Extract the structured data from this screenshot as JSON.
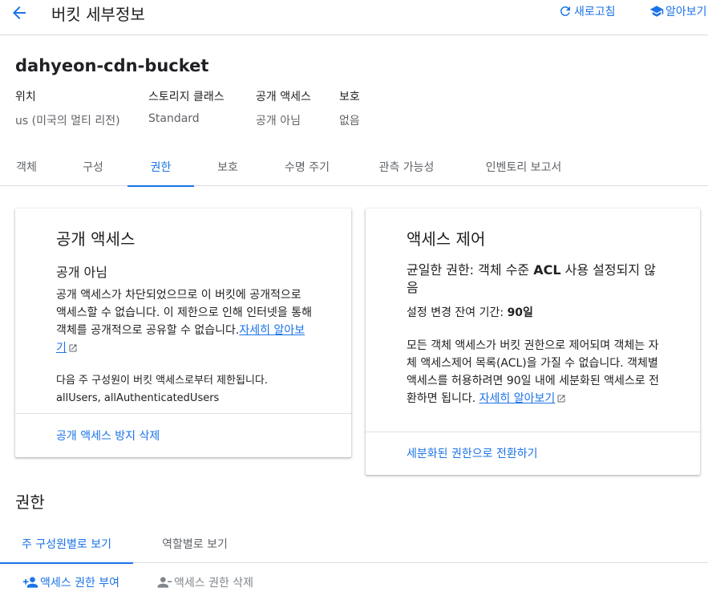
{
  "header": {
    "title": "버킷 세부정보",
    "refresh_label": "새로고침",
    "learn_label": "알아보기"
  },
  "bucket": {
    "name": "dahyeon-cdn-bucket",
    "meta": [
      {
        "label": "위치",
        "value": "us (미국의 멀티 리전)"
      },
      {
        "label": "스토리지 클래스",
        "value": "Standard"
      },
      {
        "label": "공개 액세스",
        "value": "공개 아님"
      },
      {
        "label": "보호",
        "value": "없음"
      }
    ]
  },
  "tabs": [
    "객체",
    "구성",
    "권한",
    "보호",
    "수명 주기",
    "관측 가능성",
    "인벤토리 보고서"
  ],
  "active_tab": "권한",
  "public_access_card": {
    "title": "공개 액세스",
    "status": "공개 아님",
    "desc_lines": [
      "공개 액세스가 차단되었으므로 이 버킷에 공개적으로",
      "액세스할 수 없습니다. 이 제한으로 인해 인터넷을 통해",
      "객체를 공개적으로 공유할 수 없습니다."
    ],
    "learn_more_a": "자세히 알아보",
    "learn_more_b": "기",
    "restricted_note": "다음 주 구성원이 버킷 액세스로부터 제한됩니다.",
    "principals": "allUsers, allAuthenticatedUsers",
    "action": "공개 액세스 방지 삭제"
  },
  "access_control_card": {
    "title": "액세스 제어",
    "subtitle_prefix": "균일한 권한: 객체 수준 ",
    "subtitle_bold": "ACL",
    "subtitle_suffix": " 사용 설정되지 않",
    "subtitle_line2": "음",
    "remaining_label": "설정 변경 잔여 기간: ",
    "remaining_value": "90일",
    "desc_lines": [
      "모든 객체 액세스가 버킷 권한으로 제어되며 객체는 자",
      "체 액세스제어 목록(ACL)을 가질 수 없습니다. 객체별",
      "액세스를 허용하려면 90일 내에 세분화된 액세스로 전",
      "환하면 됩니다. "
    ],
    "learn_more": "자세히 알아보기",
    "action": "세분화된 권한으로 전환하기"
  },
  "permissions": {
    "title": "권한",
    "subtabs": [
      "주 구성원별로 보기",
      "역할별로 보기"
    ],
    "grant_label": "액세스 권한 부여",
    "remove_label": "액세스 권한 삭제"
  },
  "colors": {
    "accent": "#1a73e8",
    "text": "#202124",
    "muted": "#5f6368",
    "disabled": "#80868b"
  }
}
